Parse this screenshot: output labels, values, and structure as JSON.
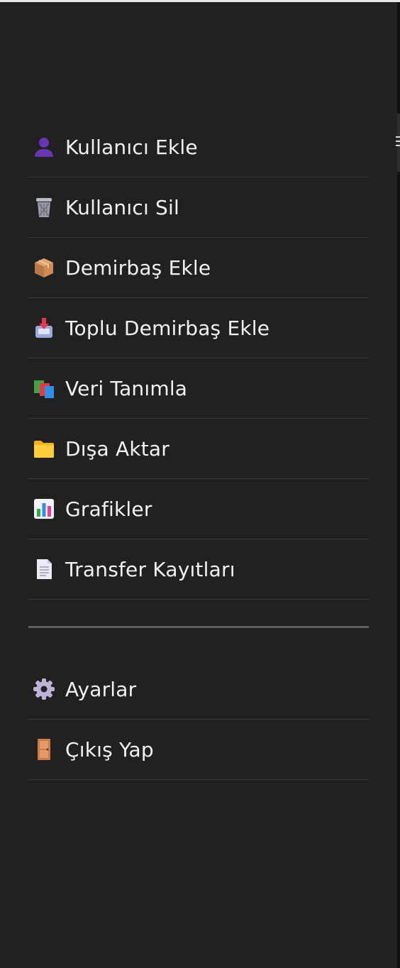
{
  "menu": {
    "items": [
      {
        "label": "Kullanıcı Ekle",
        "icon": "user-icon"
      },
      {
        "label": "Kullanıcı Sil",
        "icon": "trash-icon"
      },
      {
        "label": "Demirbaş Ekle",
        "icon": "package-icon"
      },
      {
        "label": "Toplu Demirbaş Ekle",
        "icon": "inbox-tray-icon"
      },
      {
        "label": "Veri Tanımla",
        "icon": "books-icon"
      },
      {
        "label": "Dışa Aktar",
        "icon": "folder-icon"
      },
      {
        "label": "Grafikler",
        "icon": "bar-chart-icon"
      },
      {
        "label": "Transfer Kayıtları",
        "icon": "document-icon"
      }
    ],
    "bottom_items": [
      {
        "label": "Ayarlar",
        "icon": "gear-icon"
      },
      {
        "label": "Çıkış Yap",
        "icon": "door-icon"
      }
    ]
  },
  "colors": {
    "drawer_background": "#212121",
    "text": "#f2f2f2",
    "divider": "#3a3a3a",
    "separator": "#5f5f5f"
  }
}
